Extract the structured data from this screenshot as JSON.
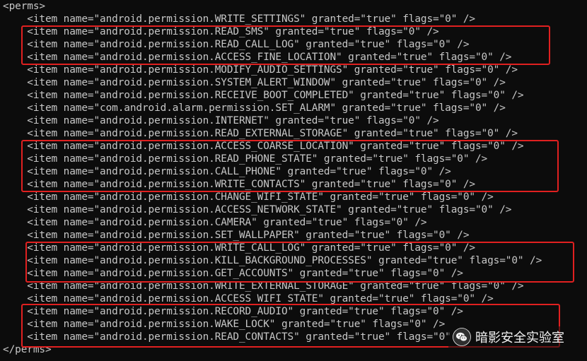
{
  "terminal": {
    "lines": [
      "<perms>",
      "    <item name=\"android.permission.WRITE_SETTINGS\" granted=\"true\" flags=\"0\" />",
      "    <item name=\"android.permission.READ_SMS\" granted=\"true\" flags=\"0\" />",
      "    <item name=\"android.permission.READ_CALL_LOG\" granted=\"true\" flags=\"0\" />",
      "    <item name=\"android.permission.ACCESS_FINE_LOCATION\" granted=\"true\" flags=\"0\" />",
      "    <item name=\"android.permission.MODIFY_AUDIO_SETTINGS\" granted=\"true\" flags=\"0\" />",
      "    <item name=\"android.permission.SYSTEM_ALERT_WINDOW\" granted=\"true\" flags=\"0\" />",
      "    <item name=\"android.permission.RECEIVE_BOOT_COMPLETED\" granted=\"true\" flags=\"0\" />",
      "    <item name=\"com.android.alarm.permission.SET_ALARM\" granted=\"true\" flags=\"0\" />",
      "    <item name=\"android.permission.INTERNET\" granted=\"true\" flags=\"0\" />",
      "    <item name=\"android.permission.READ_EXTERNAL_STORAGE\" granted=\"true\" flags=\"0\" />",
      "    <item name=\"android.permission.ACCESS_COARSE_LOCATION\" granted=\"true\" flags=\"0\" />",
      "    <item name=\"android.permission.READ_PHONE_STATE\" granted=\"true\" flags=\"0\" />",
      "    <item name=\"android.permission.CALL_PHONE\" granted=\"true\" flags=\"0\" />",
      "    <item name=\"android.permission.WRITE_CONTACTS\" granted=\"true\" flags=\"0\" />",
      "    <item name=\"android.permission.CHANGE_WIFI_STATE\" granted=\"true\" flags=\"0\" />",
      "    <item name=\"android.permission.ACCESS_NETWORK_STATE\" granted=\"true\" flags=\"0\" />",
      "    <item name=\"android.permission.CAMERA\" granted=\"true\" flags=\"0\" />",
      "    <item name=\"android.permission.SET_WALLPAPER\" granted=\"true\" flags=\"0\" />",
      "    <item name=\"android.permission.WRITE_CALL_LOG\" granted=\"true\" flags=\"0\" />",
      "    <item name=\"android.permission.KILL_BACKGROUND_PROCESSES\" granted=\"true\" flags=\"0\" />",
      "    <item name=\"android.permission.GET_ACCOUNTS\" granted=\"true\" flags=\"0\" />",
      "    <item name=\"android.permission.WRITE_EXTERNAL_STORAGE\" granted=\"true\" flags=\"0\" />",
      "    <item name=\"android.permission.ACCESS_WIFI_STATE\" granted=\"true\" flags=\"0\" />",
      "    <item name=\"android.permission.RECORD_AUDIO\" granted=\"true\" flags=\"0\" />",
      "    <item name=\"android.permission.WAKE_LOCK\" granted=\"true\" flags=\"0\" />",
      "    <item name=\"android.permission.READ_CONTACTS\" granted=\"true\" flags=\"0\" />",
      "</perms>"
    ]
  },
  "highlight_color": "#e02020",
  "watermark": {
    "icon": "wechat-icon",
    "text": "暗影安全实验室"
  }
}
